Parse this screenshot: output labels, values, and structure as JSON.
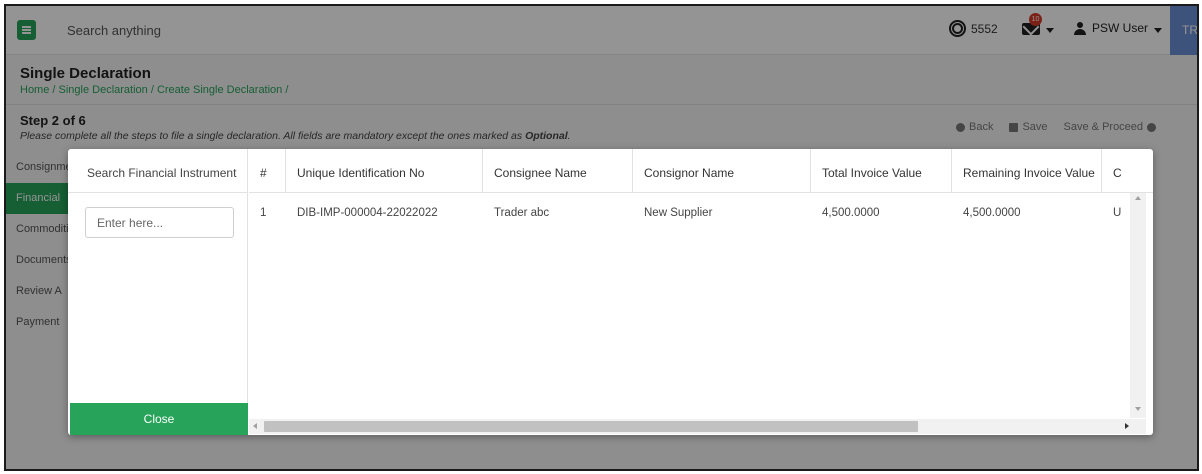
{
  "topbar": {
    "search_placeholder": "Search anything",
    "credits": "5552",
    "notification_count": "10",
    "user_name": "PSW User",
    "language": "TR"
  },
  "page": {
    "title": "Single Declaration",
    "breadcrumb": "Home / Single Declaration / Create Single Declaration /",
    "step_title": "Step 2 of 6",
    "step_desc_prefix": "Please complete all the steps to file a single declaration. All fields are mandatory except the ones marked as ",
    "step_desc_bold": "Optional",
    "step_desc_suffix": ".",
    "back_label": "Back",
    "save_label": "Save",
    "save_proceed_label": "Save & Proceed"
  },
  "steps": [
    {
      "label": "Consignment"
    },
    {
      "label": "Financial"
    },
    {
      "label": "Commodities"
    },
    {
      "label": "Documents"
    },
    {
      "label": "Review A"
    },
    {
      "label": "Payment"
    }
  ],
  "colors": {
    "accent": "#27a35a",
    "language_bg": "#6b8fd6",
    "badge": "#d63a2a"
  },
  "modal": {
    "search_title": "Search Financial Instrument",
    "search_placeholder": "Enter here...",
    "close_label": "Close",
    "columns": [
      "#",
      "Unique Identification No",
      "Consignee Name",
      "Consignor Name",
      "Total Invoice Value",
      "Remaining Invoice Value",
      "C"
    ],
    "rows": [
      {
        "num": "1",
        "uin": "DIB-IMP-000004-22022022",
        "consignee": "Trader abc",
        "consignor": "New Supplier",
        "total": "4,500.0000",
        "remaining": "4,500.0000",
        "extra": "U"
      }
    ]
  }
}
